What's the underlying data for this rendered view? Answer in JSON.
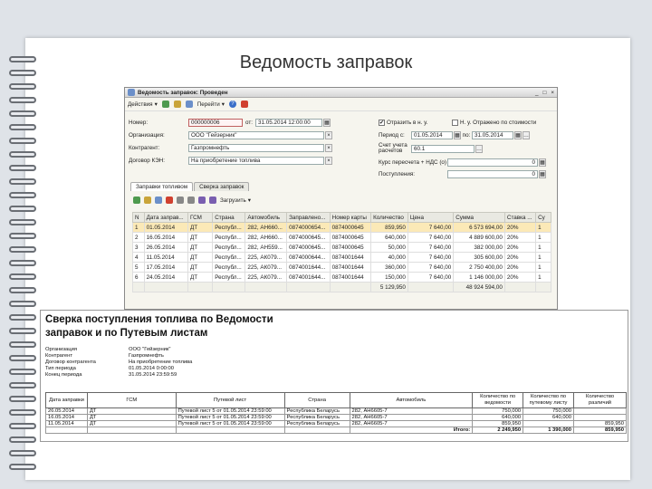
{
  "slide": {
    "title": "Ведомость заправок"
  },
  "window": {
    "title": "Ведомость заправок: Проведен",
    "controls": [
      "_",
      "□",
      "×"
    ]
  },
  "toolbar": {
    "actions_label": "Действия",
    "goto_label": "Перейти",
    "help_label": "?"
  },
  "form": {
    "number_label": "Номер:",
    "number_value": "000000006",
    "from_label": "от:",
    "date_value": "31.05.2014 12:00:00",
    "contractor_label": "Организация:",
    "contractor_value": "ООО \"Гейзерник\"",
    "counterparty_label": "Контрагент:",
    "counterparty_value": "Газпромнефть",
    "contract_label": "Договор КЭН:",
    "contract_value": "На приобретение топлива",
    "reflect_nu_label": "Отразить в н. у.",
    "reflect_nu_checked": "✔",
    "reflect_uu_label": "Н. у. Отражено по стоимости",
    "period_label": "Период с:",
    "period_from": "01.05.2014",
    "period_to_label": "по:",
    "period_to": "31.05.2014",
    "account_label": "Счет учета расчетов",
    "account_value": "60.1",
    "rate_label": "Курс пересчета + НДС (о)",
    "rate_value": "0",
    "comment_label": "Поступления:",
    "comment_value": "0"
  },
  "tabs": [
    "Заправки топливом",
    "Сверка заправок"
  ],
  "subtoolbar": {
    "load_label": "Загрузить"
  },
  "grid": {
    "headers": [
      "N",
      "Дата заправ...",
      "ГСМ",
      "Страна",
      "Автомобиль",
      "Заправлено...",
      "Номер карты",
      "Количество",
      "Цена",
      "Сумма",
      "Ставка ...",
      "Су"
    ],
    "rows": [
      [
        "1",
        "01.05.2014",
        "ДТ",
        "Республ...",
        "282, АН660...",
        "0874000654...",
        "0874000645",
        "859,950",
        "7 640,00",
        "6 573 694,00",
        "20%",
        "1"
      ],
      [
        "2",
        "16.05.2014",
        "ДТ",
        "Республ...",
        "282, АН660...",
        "0874000645...",
        "0874000645",
        "640,000",
        "7 640,00",
        "4 889 600,00",
        "20%",
        "1"
      ],
      [
        "3",
        "26.05.2014",
        "ДТ",
        "Республ...",
        "282, АН559...",
        "0874000645...",
        "0874000645",
        "50,000",
        "7 640,00",
        "382 000,00",
        "20%",
        "1"
      ],
      [
        "4",
        "11.05.2014",
        "ДТ",
        "Республ...",
        "225, АК079...",
        "0874000644...",
        "0874001644",
        "40,000",
        "7 640,00",
        "305 600,00",
        "20%",
        "1"
      ],
      [
        "5",
        "17.05.2014",
        "ДТ",
        "Республ...",
        "225, АК079...",
        "0874001644...",
        "0874001644",
        "360,000",
        "7 640,00",
        "2 750 400,00",
        "20%",
        "1"
      ],
      [
        "6",
        "24.05.2014",
        "ДТ",
        "Республ...",
        "225, АК079...",
        "0874001644...",
        "0874001644",
        "150,000",
        "7 640,00",
        "1 146 000,00",
        "20%",
        "1"
      ]
    ],
    "total_qty": "5 129,950",
    "total_sum": "48 924 594,00"
  },
  "report": {
    "title_line1": "Сверка поступления топлива по Ведомости",
    "title_line2": "заправок и по Путевым листам",
    "meta": [
      {
        "k": "Организация",
        "v": "ООО \"Гейзерник\""
      },
      {
        "k": "Контрагент",
        "v": "Газпромнефть"
      },
      {
        "k": "Договор контрагента",
        "v": "На приобретение топлива"
      },
      {
        "k": "Тип периода",
        "v": "01.05.2014 0:00:00"
      },
      {
        "k": "Конец периода",
        "v": "31.05.2014 23:59:59"
      }
    ],
    "headers": [
      "Дата заправки",
      "ГСМ",
      "Путевой лист",
      "Страна",
      "Автомобиль",
      "Количество по ведомости",
      "Количество по путевому листу",
      "Количество различий"
    ],
    "rows": [
      [
        "26.05.2014",
        "ДТ",
        "Путевой лист 5 от 01.05.2014 23:59:00",
        "Республика Беларусь",
        "282, АН6605-7",
        "750,000",
        "750,000",
        ""
      ],
      [
        "16.05.2014",
        "ДТ",
        "Путевой лист 5 от 01.05.2014 23:59:00",
        "Республика Беларусь",
        "282, АН6605-7",
        "640,000",
        "640,000",
        ""
      ],
      [
        "11.05.2014",
        "ДТ",
        "Путевой лист 5 от 01.05.2014 23:59:00",
        "Республика Беларусь",
        "282, АН6605-7",
        "859,950",
        "",
        "859,950"
      ]
    ],
    "total_label": "Итого:",
    "total_vals": [
      "2 249,950",
      "1 390,000",
      "859,950"
    ]
  }
}
